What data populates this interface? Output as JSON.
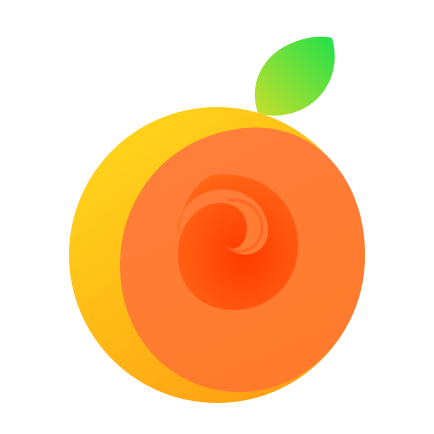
{
  "logo": {
    "name": "orange-fruit-logo",
    "icon": "orange-spiral-with-leaf-icon",
    "colors": {
      "background": "#ffffff",
      "outer_light": "#ffd21a",
      "outer_dark": "#ff9d12",
      "middle": "#ff7e3b",
      "middle_dark": "#ff6a1a",
      "core": "#ff3b00",
      "leaf_light": "#c8df2c",
      "leaf_dark": "#22e04a"
    }
  }
}
